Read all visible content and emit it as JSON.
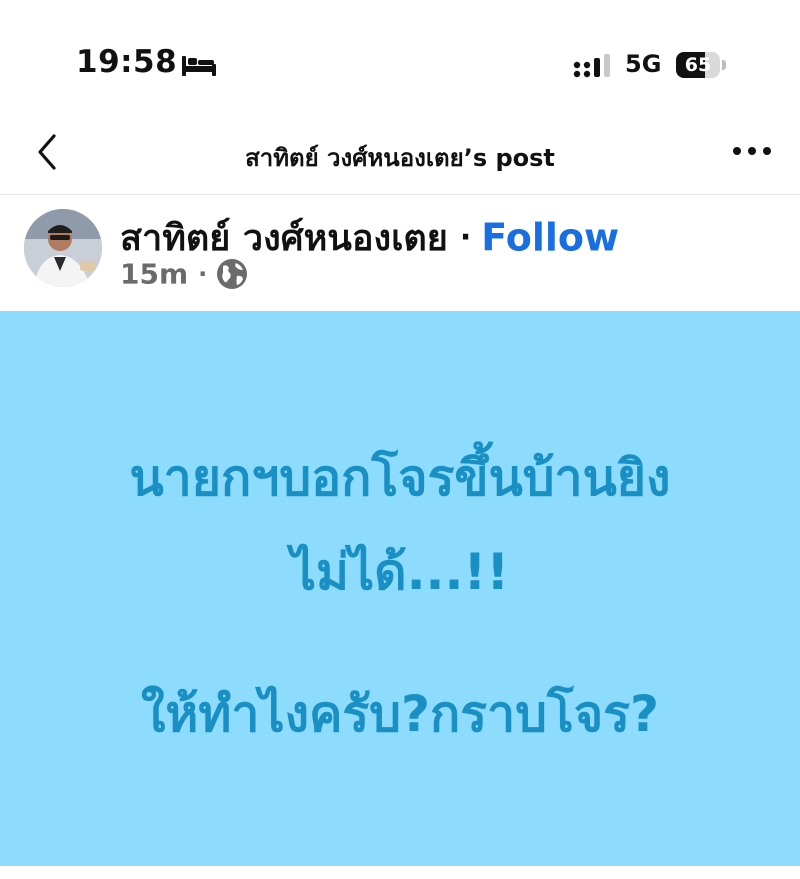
{
  "status_bar": {
    "time": "19:58",
    "network": "5G",
    "battery": "65",
    "battery_level": 0.65,
    "icons": [
      "bed-icon",
      "signal-icon",
      "battery-icon"
    ]
  },
  "nav": {
    "title": "สาทิตย์ วงศ์หนองเตย’s post",
    "icons": [
      "back-chevron-icon",
      "more-options-icon"
    ]
  },
  "post": {
    "author": "สาทิตย์ วงศ์หนองเตย",
    "separator": "·",
    "follow_label": "Follow",
    "time": "15m",
    "meta_separator": "·",
    "audience_icon": "globe-icon",
    "lines": [
      "นายกฯบอกโจรขึ้นบ้านยิง",
      "ไม่ได้...!!",
      "ให้ทำไงครับ?กราบโจร?"
    ]
  },
  "colors": {
    "follow": "#1a6fe0",
    "post_background": "#8edcfd",
    "post_text": "#1a8fc4"
  }
}
